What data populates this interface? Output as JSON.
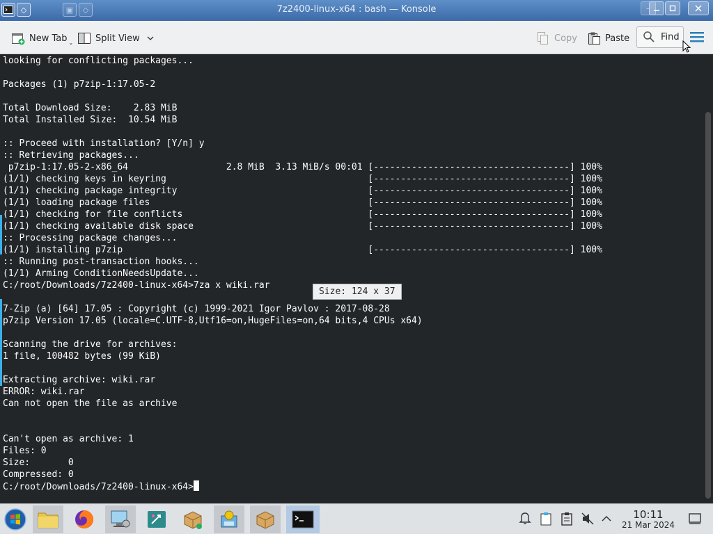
{
  "window": {
    "title": "7z2400-linux-x64 : bash — Konsole"
  },
  "toolbar": {
    "new_tab_label": "New Tab",
    "split_view_label": "Split View",
    "copy_label": "Copy",
    "paste_label": "Paste",
    "find_label": "Find"
  },
  "terminal": {
    "lines": [
      "looking for conflicting packages...",
      "",
      "Packages (1) p7zip-1:17.05-2",
      "",
      "Total Download Size:    2.83 MiB",
      "Total Installed Size:  10.54 MiB",
      "",
      ":: Proceed with installation? [Y/n] y",
      ":: Retrieving packages...",
      " p7zip-1:17.05-2-x86_64                  2.8 MiB  3.13 MiB/s 00:01 [------------------------------------] 100%",
      "(1/1) checking keys in keyring                                     [------------------------------------] 100%",
      "(1/1) checking package integrity                                   [------------------------------------] 100%",
      "(1/1) loading package files                                        [------------------------------------] 100%",
      "(1/1) checking for file conflicts                                  [------------------------------------] 100%",
      "(1/1) checking available disk space                                [------------------------------------] 100%",
      ":: Processing package changes...",
      "(1/1) installing p7zip                                             [------------------------------------] 100%",
      ":: Running post-transaction hooks...",
      "(1/1) Arming ConditionNeedsUpdate...",
      "C:/root/Downloads/7z2400-linux-x64>7za x wiki.rar",
      "",
      "7-Zip (a) [64] 17.05 : Copyright (c) 1999-2021 Igor Pavlov : 2017-08-28",
      "p7zip Version 17.05 (locale=C.UTF-8,Utf16=on,HugeFiles=on,64 bits,4 CPUs x64)",
      "",
      "Scanning the drive for archives:",
      "1 file, 100482 bytes (99 KiB)",
      "",
      "Extracting archive: wiki.rar",
      "ERROR: wiki.rar",
      "Can not open the file as archive",
      "",
      "",
      "Can't open as archive: 1",
      "Files: 0",
      "Size:       0",
      "Compressed: 0",
      "C:/root/Downloads/7z2400-linux-x64>"
    ],
    "size_tooltip": "Size: 124 x 37"
  },
  "taskbar": {
    "time": "10:11",
    "date": "21 Mar 2024"
  },
  "colors": {
    "terminal_bg": "#232629",
    "terminal_fg": "#fcfcfc",
    "accent": "#3daee9"
  }
}
